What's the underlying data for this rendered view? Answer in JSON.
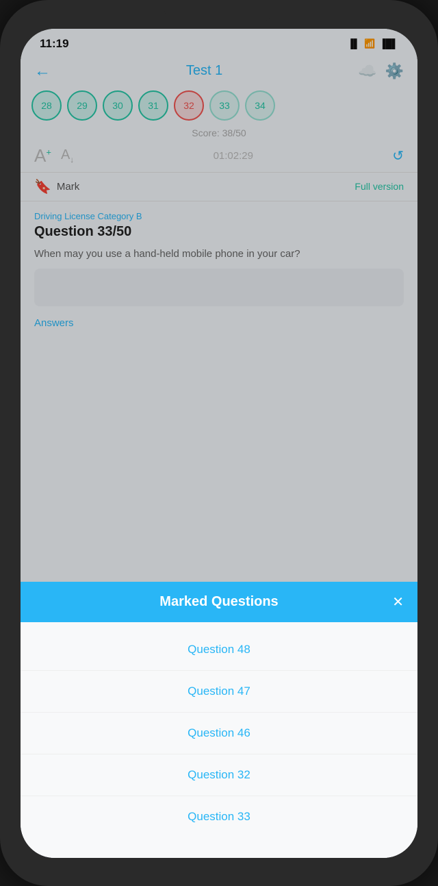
{
  "status_bar": {
    "time": "11:19",
    "signal": "📶",
    "wifi": "WiFi",
    "battery": "🔋"
  },
  "header": {
    "back_label": "←",
    "title": "Test 1",
    "cloud_icon": "☁",
    "filter_icon": "⚙"
  },
  "question_numbers": [
    {
      "num": "28",
      "state": "green"
    },
    {
      "num": "29",
      "state": "green"
    },
    {
      "num": "30",
      "state": "green"
    },
    {
      "num": "31",
      "state": "green"
    },
    {
      "num": "32",
      "state": "red"
    },
    {
      "num": "33",
      "state": "teal"
    },
    {
      "num": "34",
      "state": "teal"
    }
  ],
  "score": {
    "label": "Score: 38/50"
  },
  "font_timer": {
    "font_up": "A",
    "font_down": "A",
    "timer": "01:02:29",
    "refresh_icon": "↺"
  },
  "mark_row": {
    "bookmark_icon": "🔖",
    "mark_label": "Mark",
    "full_version_label": "Full version"
  },
  "question": {
    "category": "Driving License Category B",
    "title": "Question 33/50",
    "body": "When may you use a hand-held mobile phone in your car?"
  },
  "answers": {
    "label": "Answers"
  },
  "modal": {
    "title": "Marked Questions",
    "close_icon": "✕",
    "items": [
      {
        "label": "Question 48"
      },
      {
        "label": "Question 47"
      },
      {
        "label": "Question 46"
      },
      {
        "label": "Question 32"
      },
      {
        "label": "Question 33"
      }
    ]
  }
}
